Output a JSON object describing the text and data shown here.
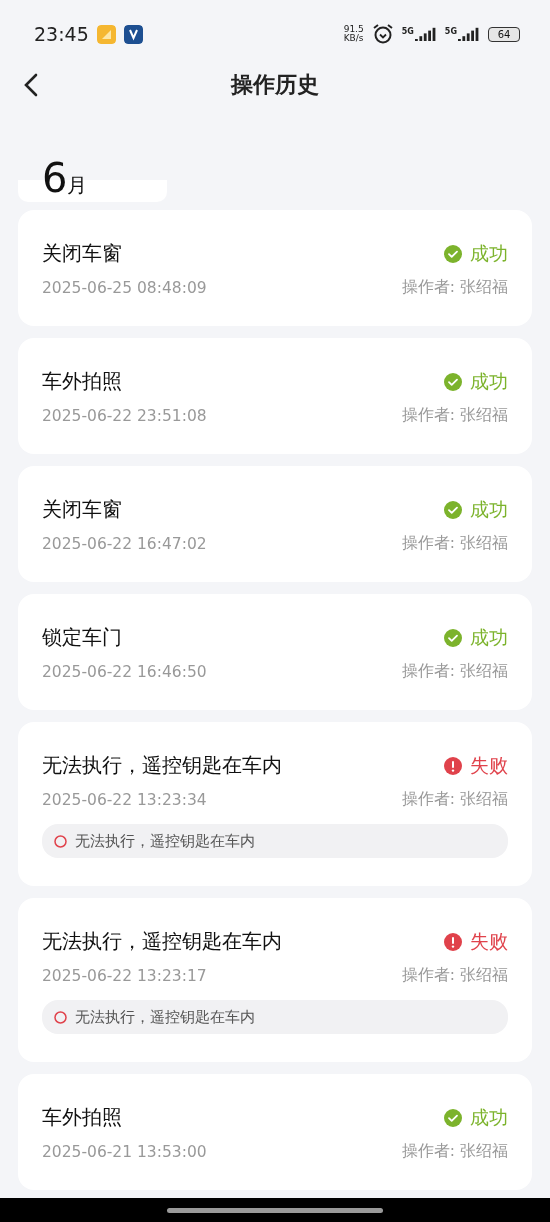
{
  "status_bar": {
    "time": "23:45",
    "net_speed": "91.5",
    "net_unit": "KB/s",
    "signals": [
      "5G",
      "5G"
    ],
    "battery": "64"
  },
  "header": {
    "title": "操作历史"
  },
  "month": {
    "number": "6",
    "unit": "月"
  },
  "records": [
    {
      "action": "关闭车窗",
      "time": "2025-06-25 08:48:09",
      "operator": "操作者: 张绍福",
      "kind": "success",
      "status": "成功"
    },
    {
      "action": "车外拍照",
      "time": "2025-06-22 23:51:08",
      "operator": "操作者: 张绍福",
      "kind": "success",
      "status": "成功"
    },
    {
      "action": "关闭车窗",
      "time": "2025-06-22 16:47:02",
      "operator": "操作者: 张绍福",
      "kind": "success",
      "status": "成功"
    },
    {
      "action": "锁定车门",
      "time": "2025-06-22 16:46:50",
      "operator": "操作者: 张绍福",
      "kind": "success",
      "status": "成功"
    },
    {
      "action": "无法执行，遥控钥匙在车内",
      "time": "2025-06-22 13:23:34",
      "operator": "操作者: 张绍福",
      "kind": "failure",
      "status": "失败",
      "note": "无法执行，遥控钥匙在车内"
    },
    {
      "action": "无法执行，遥控钥匙在车内",
      "time": "2025-06-22 13:23:17",
      "operator": "操作者: 张绍福",
      "kind": "failure",
      "status": "失败",
      "note": "无法执行，遥控钥匙在车内"
    },
    {
      "action": "车外拍照",
      "time": "2025-06-21 13:53:00",
      "operator": "操作者: 张绍福",
      "kind": "success",
      "status": "成功"
    }
  ]
}
